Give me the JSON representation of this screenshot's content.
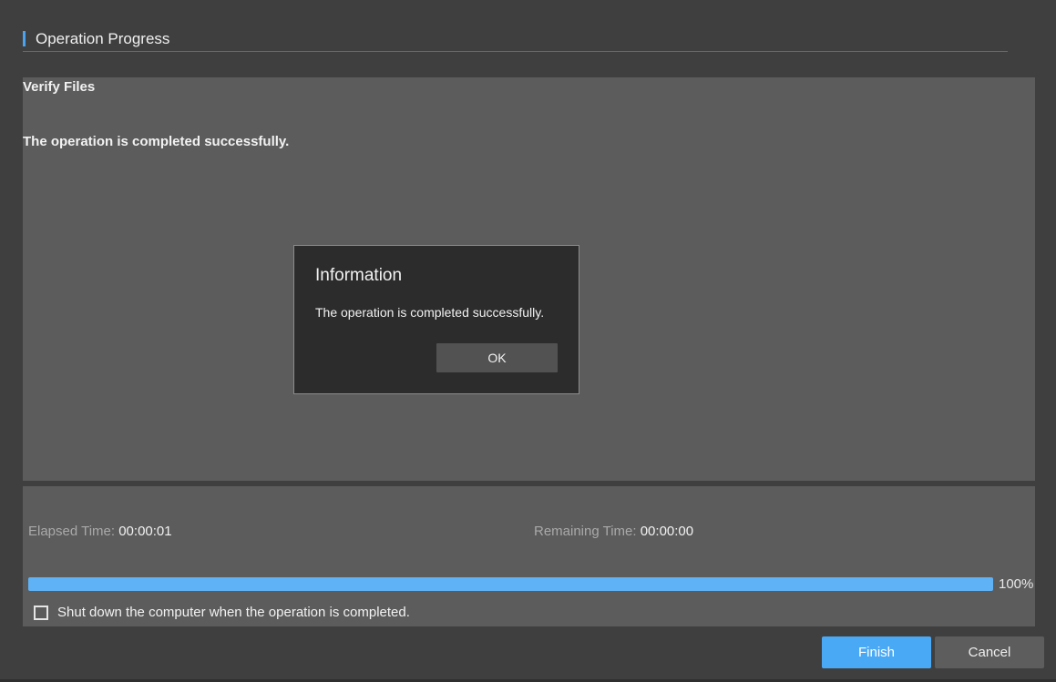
{
  "header": {
    "title": "Operation Progress"
  },
  "log": {
    "lines": [
      "Verify Files",
      "The operation is completed successfully."
    ]
  },
  "status": {
    "elapsed_label": "Elapsed Time:",
    "elapsed_value": "00:00:01",
    "remaining_label": "Remaining Time:",
    "remaining_value": "00:00:00",
    "progress_fraction": 1.0,
    "progress_text": "100%",
    "shutdown_checked": false,
    "shutdown_label": "Shut down the computer when the operation is completed."
  },
  "footer": {
    "finish_label": "Finish",
    "cancel_label": "Cancel"
  },
  "dialog": {
    "title": "Information",
    "message": "The operation is completed successfully.",
    "ok_label": "OK"
  },
  "colors": {
    "accent": "#4aa9f5",
    "progress": "#5fb2f5",
    "panel": "#5c5c5c",
    "background": "#3f3f3f",
    "dialog_bg": "#2c2c2c"
  }
}
